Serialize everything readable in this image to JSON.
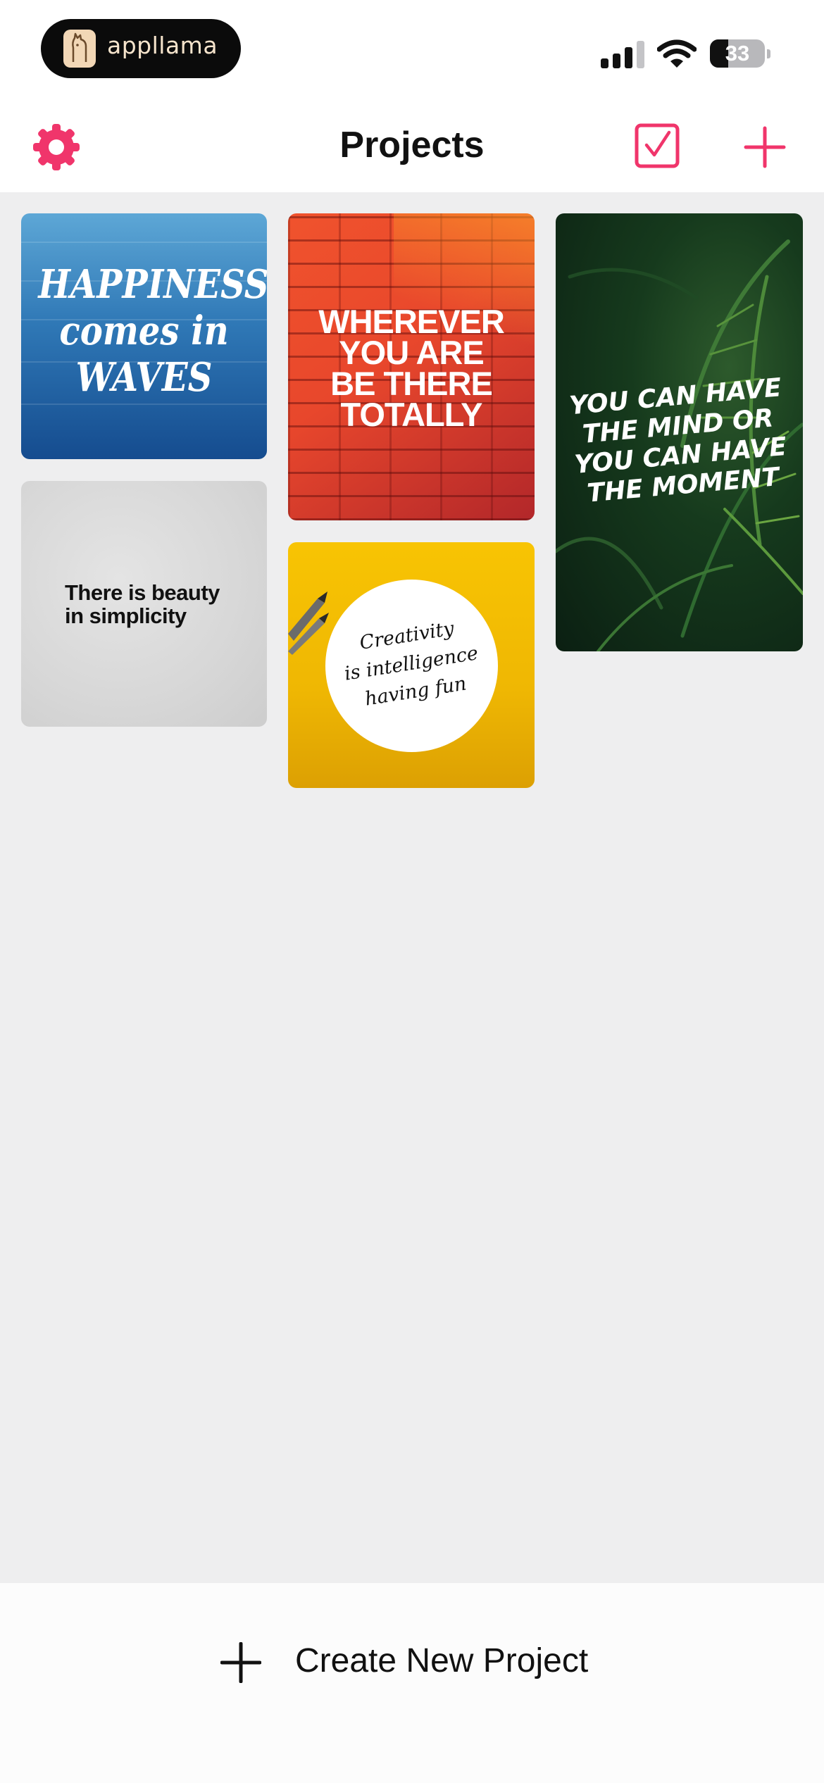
{
  "status_bar": {
    "app_pill_label": "appllama",
    "battery_percent": "33",
    "battery_level": 0.33,
    "signal_bars_active": 3,
    "signal_bars_total": 4
  },
  "nav": {
    "title": "Projects",
    "accent_color": "#f0356b"
  },
  "projects": [
    {
      "id": "waves",
      "quote": "HAPPINESS\ncomes in\nWAVES"
    },
    {
      "id": "wall",
      "quote": "WHEREVER\nYOU ARE\nBE THERE\nTOTALLY"
    },
    {
      "id": "palm",
      "quote": "YOU CAN HAVE\nTHE MIND OR\nYOU CAN HAVE\nTHE MOMENT"
    },
    {
      "id": "concrete",
      "quote": "There is beauty\nin simplicity"
    },
    {
      "id": "yellow",
      "quote": "Creativity\nis intelligence\nhaving fun"
    }
  ],
  "bottom_bar": {
    "create_label": "Create New Project"
  },
  "icons": {
    "settings": "gear-icon",
    "select": "checkbox-icon",
    "add": "plus-icon",
    "create": "plus-icon"
  }
}
